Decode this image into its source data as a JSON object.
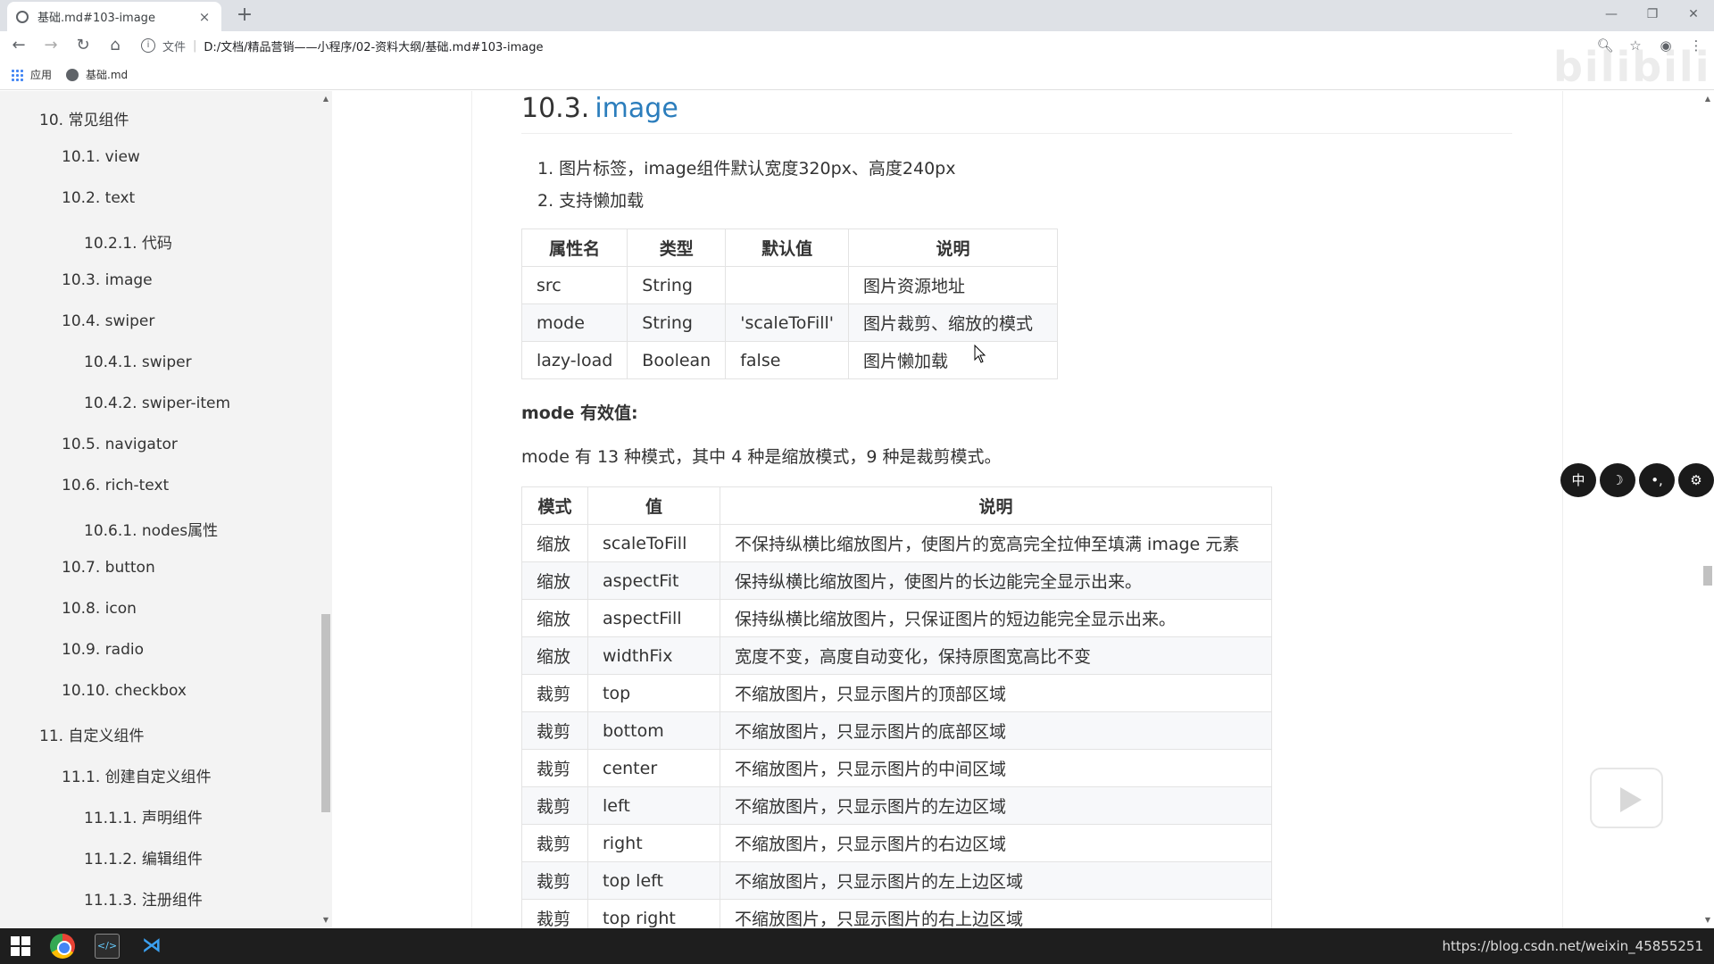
{
  "browser": {
    "tab_title": "基础.md#103-image",
    "tab_close": "×",
    "new_tab": "+",
    "address_file_label": "文件",
    "address_sep": "|",
    "address_url": "D:/文档/精品营销——小程序/02-资料大纲/基础.md#103-image",
    "bookmarks": [
      {
        "label": "应用",
        "icon": "apps-grid-icon"
      },
      {
        "label": "基础.md",
        "icon": "globe-icon"
      }
    ]
  },
  "sidebar": {
    "items": [
      {
        "label": "10. 常见组件",
        "level": 1
      },
      {
        "label": "10.1. view",
        "level": 2
      },
      {
        "label": "10.2. text",
        "level": 2
      },
      {
        "label": "10.2.1. 代码",
        "level": 3
      },
      {
        "label": "10.3. image",
        "level": 2
      },
      {
        "label": "10.4. swiper",
        "level": 2
      },
      {
        "label": "10.4.1. swiper",
        "level": 3
      },
      {
        "label": "10.4.2. swiper-item",
        "level": 3
      },
      {
        "label": "10.5. navigator",
        "level": 2
      },
      {
        "label": "10.6. rich-text",
        "level": 2
      },
      {
        "label": "10.6.1. nodes属性",
        "level": 3
      },
      {
        "label": "10.7. button",
        "level": 2
      },
      {
        "label": "10.8. icon",
        "level": 2
      },
      {
        "label": "10.9. radio",
        "level": 2
      },
      {
        "label": "10.10. checkbox",
        "level": 2
      },
      {
        "label": "11. 自定义组件",
        "level": 1
      },
      {
        "label": "11.1. 创建自定义组件",
        "level": 2
      },
      {
        "label": "11.1.1. 声明组件",
        "level": 3
      },
      {
        "label": "11.1.2. 编辑组件",
        "level": 3
      },
      {
        "label": "11.1.3. 注册组件",
        "level": 3
      }
    ]
  },
  "doc": {
    "heading_number": "10.3.",
    "heading_link": "image",
    "list": [
      "1. 图片标签，image组件默认宽度320px、高度240px",
      "2. 支持懒加载"
    ],
    "attr_table": {
      "headers": [
        "属性名",
        "类型",
        "默认值",
        "说明"
      ],
      "rows": [
        [
          "src",
          "String",
          "",
          "图片资源地址"
        ],
        [
          "mode",
          "String",
          "'scaleToFill'",
          "图片裁剪、缩放的模式"
        ],
        [
          "lazy-load",
          "Boolean",
          "false",
          "图片懒加载"
        ]
      ]
    },
    "mode_title": "mode 有效值:",
    "mode_desc": "mode 有 13 种模式，其中 4 种是缩放模式，9 种是裁剪模式。",
    "mode_table": {
      "headers": [
        "模式",
        "值",
        "说明"
      ],
      "rows": [
        [
          "缩放",
          "scaleToFill",
          "不保持纵横比缩放图片，使图片的宽高完全拉伸至填满 image 元素"
        ],
        [
          "缩放",
          "aspectFit",
          "保持纵横比缩放图片，使图片的长边能完全显示出来。"
        ],
        [
          "缩放",
          "aspectFill",
          "保持纵横比缩放图片，只保证图片的短边能完全显示出来。"
        ],
        [
          "缩放",
          "widthFix",
          "宽度不变，高度自动变化，保持原图宽高比不变"
        ],
        [
          "裁剪",
          "top",
          "不缩放图片，只显示图片的顶部区域"
        ],
        [
          "裁剪",
          "bottom",
          "不缩放图片，只显示图片的底部区域"
        ],
        [
          "裁剪",
          "center",
          "不缩放图片，只显示图片的中间区域"
        ],
        [
          "裁剪",
          "left",
          "不缩放图片，只显示图片的左边区域"
        ],
        [
          "裁剪",
          "right",
          "不缩放图片，只显示图片的右边区域"
        ],
        [
          "裁剪",
          "top left",
          "不缩放图片，只显示图片的左上边区域"
        ],
        [
          "裁剪",
          "top right",
          "不缩放图片，只显示图片的右上边区域"
        ]
      ]
    }
  },
  "float_buttons": [
    "中",
    "☽",
    "•,",
    "⚙"
  ],
  "taskbar": {
    "url_text": "https://blog.csdn.net/weixin_45855251"
  },
  "colors": {
    "link": "#2b7dbc",
    "sidebar_bg": "#f3f3f3",
    "taskbar_bg": "#1e1e1e"
  }
}
